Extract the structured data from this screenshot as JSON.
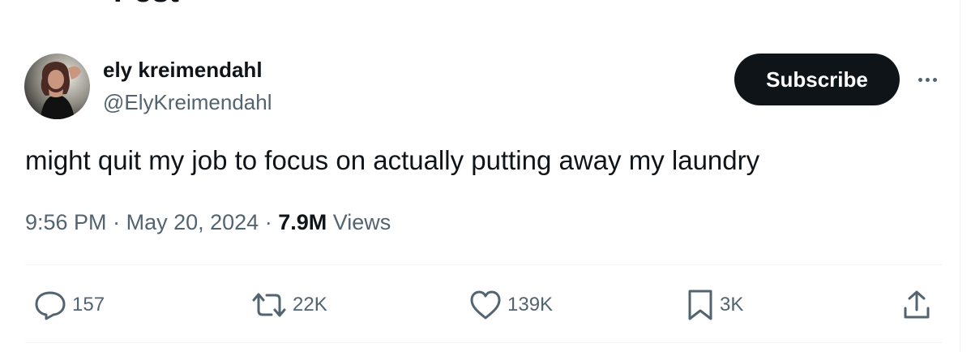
{
  "header": {
    "title": "Post"
  },
  "author": {
    "display_name": "ely kreimendahl",
    "handle": "@ElyKreimendahl"
  },
  "subscribe_label": "Subscribe",
  "tweet": {
    "text": "might quit my job to focus on actually putting away my laundry",
    "time": "9:56 PM",
    "date": "May 20, 2024",
    "views_count": "7.9M",
    "views_label": "Views"
  },
  "actions": {
    "replies": "157",
    "reposts": "22K",
    "likes": "139K",
    "bookmarks": "3K"
  },
  "icons": {
    "reply": "reply-icon",
    "repost": "repost-icon",
    "like": "heart-icon",
    "bookmark": "bookmark-icon",
    "share": "share-icon",
    "more": "more-icon"
  },
  "colors": {
    "text_primary": "#0f1419",
    "text_secondary": "#536471",
    "divider": "#eff3f4",
    "button_bg": "#0f1419"
  }
}
